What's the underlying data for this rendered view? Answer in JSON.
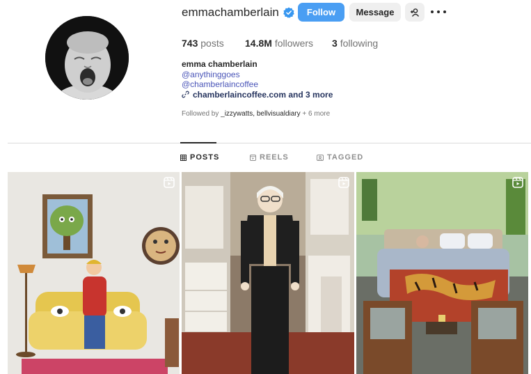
{
  "profile": {
    "username": "emmachamberlain",
    "follow_label": "Follow",
    "message_label": "Message"
  },
  "stats": {
    "posts_count": "743",
    "posts_label": "posts",
    "followers_count": "14.8M",
    "followers_label": "followers",
    "following_count": "3",
    "following_label": "following"
  },
  "bio": {
    "name": "emma chamberlain",
    "links": [
      "@anythinggoes",
      "@chamberlaincoffee"
    ],
    "external_link": "chamberlaincoffee.com and 3 more"
  },
  "followed_by": {
    "prefix": "Followed by",
    "names": "_izzywatts, bellvisualdiary",
    "suffix": "+ 6 more"
  },
  "tabs": [
    {
      "label": "POSTS",
      "icon": "grid-icon",
      "active": true
    },
    {
      "label": "REELS",
      "icon": "reels-icon",
      "active": false
    },
    {
      "label": "TAGGED",
      "icon": "tagged-icon",
      "active": false
    }
  ],
  "colors": {
    "follow_button": "#4a9ef3",
    "link": "#4a55b8",
    "verified": "#3897f0"
  },
  "posts": [
    {
      "type": "reel",
      "description": "illustration"
    },
    {
      "type": "reel",
      "description": "closet video"
    },
    {
      "type": "reel",
      "description": "bedroom video"
    }
  ]
}
